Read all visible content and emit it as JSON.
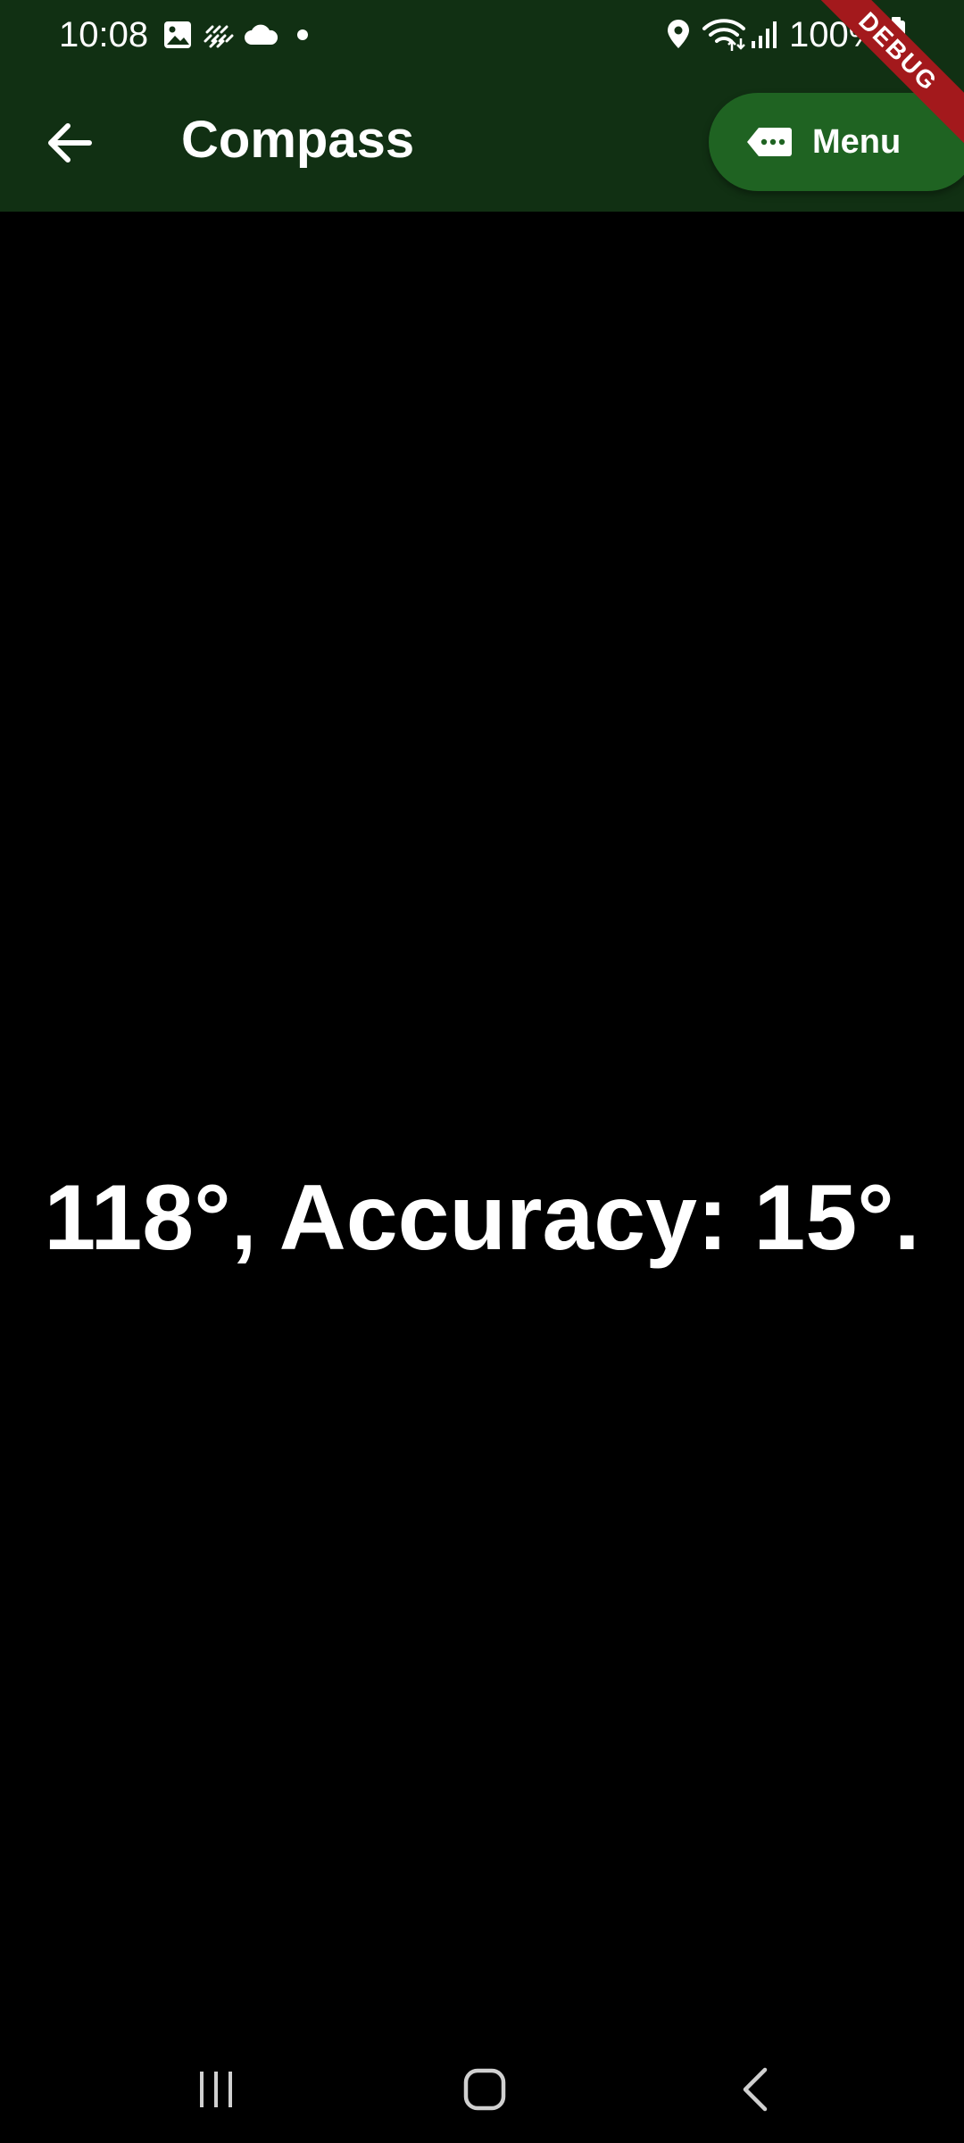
{
  "status_bar": {
    "time": "10:08",
    "battery": "100%",
    "icons": [
      "gallery-icon",
      "weather-haze-icon",
      "cloud-icon",
      "notification-dot-icon",
      "location-icon",
      "wifi-icon",
      "signal-icon",
      "battery-icon"
    ]
  },
  "app_bar": {
    "title": "Compass",
    "back_icon": "arrow-left-icon",
    "menu_label": "Menu",
    "menu_icon": "label-tag-icon",
    "color": "#113013",
    "menu_color": "#1f6322"
  },
  "debug_banner": {
    "label": "DEBUG",
    "color": "#a3191c"
  },
  "compass": {
    "reading": "118°, Accuracy: 15°."
  },
  "nav_bar": {
    "buttons": [
      "recent-apps",
      "home",
      "back"
    ]
  }
}
